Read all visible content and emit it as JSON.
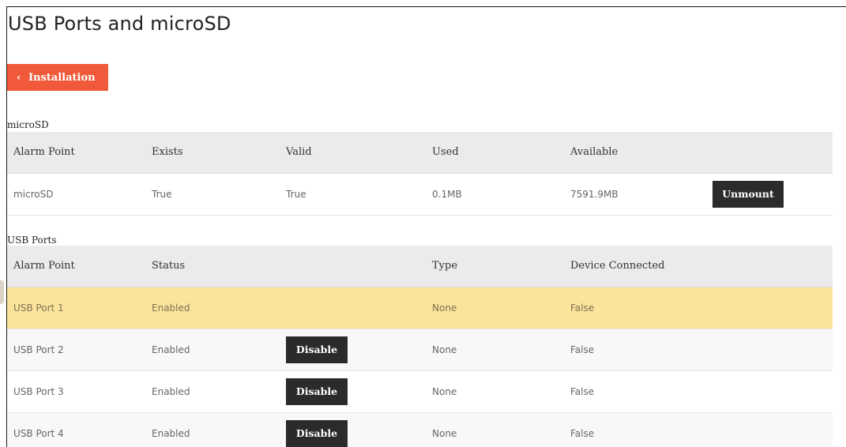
{
  "page_title": "USB Ports and microSD",
  "back_button": {
    "label": "Installation",
    "icon": "chevron-left-icon"
  },
  "microsd": {
    "section_label": "microSD",
    "columns": [
      "Alarm Point",
      "Exists",
      "Valid",
      "Used",
      "Available"
    ],
    "rows": [
      {
        "alarm_point": "microSD",
        "exists": "True",
        "valid": "True",
        "used": "0.1MB",
        "available": "7591.9MB",
        "action": "Unmount"
      }
    ]
  },
  "usb": {
    "section_label": "USB Ports",
    "columns": [
      "Alarm Point",
      "Status",
      "",
      "Type",
      "Device Connected"
    ],
    "rows": [
      {
        "alarm_point": "USB Port 1",
        "status": "Enabled",
        "action": "",
        "type": "None",
        "device_connected": "False",
        "highlighted": true
      },
      {
        "alarm_point": "USB Port 2",
        "status": "Enabled",
        "action": "Disable",
        "type": "None",
        "device_connected": "False"
      },
      {
        "alarm_point": "USB Port 3",
        "status": "Enabled",
        "action": "Disable",
        "type": "None",
        "device_connected": "False"
      },
      {
        "alarm_point": "USB Port 4",
        "status": "Enabled",
        "action": "Disable",
        "type": "None",
        "device_connected": "False"
      }
    ]
  },
  "colors": {
    "accent": "#f05a3a",
    "highlight": "#fbe39c",
    "link": "#4a7fbf",
    "dark_button": "#2b2b2b"
  }
}
